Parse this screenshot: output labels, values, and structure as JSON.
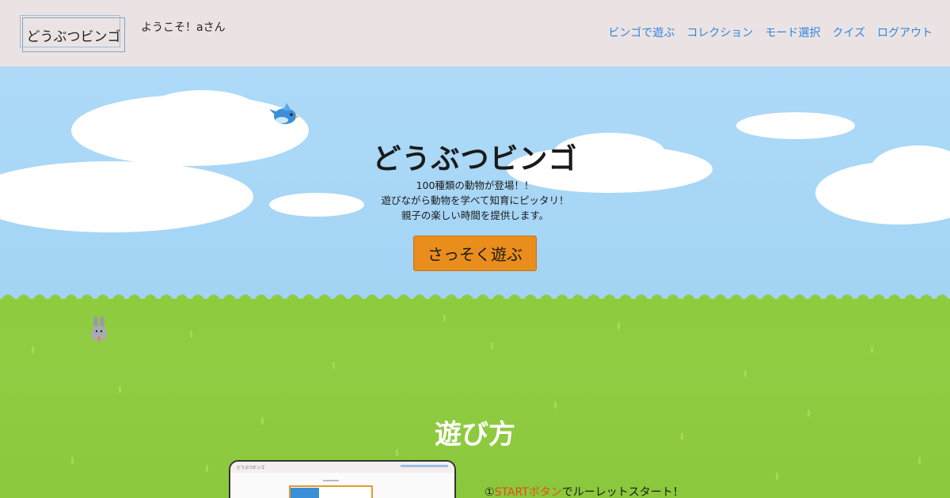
{
  "header": {
    "logo": "どうぶつビンゴ",
    "welcome": "ようこそ！aさん",
    "nav": [
      {
        "label": "ビンゴで遊ぶ"
      },
      {
        "label": "コレクション"
      },
      {
        "label": "モード選択"
      },
      {
        "label": "クイズ"
      },
      {
        "label": "ログアウト"
      }
    ]
  },
  "hero": {
    "title": "どうぶつビンゴ",
    "desc_lines": [
      "100種類の動物が登場！！",
      "遊びながら動物を学べて知育にピッタリ！",
      "親子の楽しい時間を提供します。"
    ],
    "cta": "さっそく遊ぶ"
  },
  "howto": {
    "title": "遊び方",
    "step1_num": "①",
    "step1_accent": "STARTボタン",
    "step1_rest": "でルーレットスタート！"
  },
  "colors": {
    "nav_link": "#2f86e0",
    "cta_bg": "#e98d1c",
    "header_bg": "#ebe3e3",
    "sky": "#a8d8f5",
    "grass": "#8ecb3e",
    "step_accent": "#e84a1e"
  },
  "icons": {
    "bird": "bluebird-icon",
    "rabbit": "rabbit-icon"
  }
}
